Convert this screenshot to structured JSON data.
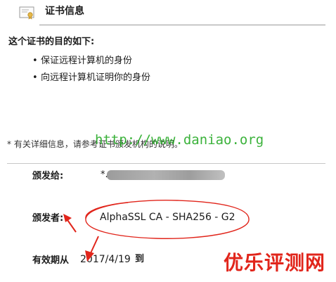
{
  "header": {
    "icon": "certificate-icon",
    "title": "证书信息"
  },
  "purpose": {
    "heading": "这个证书的目的如下:",
    "items": [
      "保证远程计算机的身份",
      "向远程计算机证明你的身份"
    ],
    "bullet": "•"
  },
  "footnote": "* 有关详细信息，请参考证书颁发机构的说明。",
  "watermark_url": "http://www.daniao.org",
  "fields": {
    "issued_to_label": "颁发给:",
    "issued_to_value": "*.",
    "issued_by_label": "颁发者:",
    "issued_by_value": "AlphaSSL CA - SHA256 - G2",
    "valid_from_label": "有效期从",
    "valid_from_value": "2017/4/19",
    "valid_to_word": "到"
  },
  "brand_watermark": "优乐评测网",
  "colors": {
    "annotation_red": "#e1251b",
    "watermark_green": "#19a519"
  }
}
